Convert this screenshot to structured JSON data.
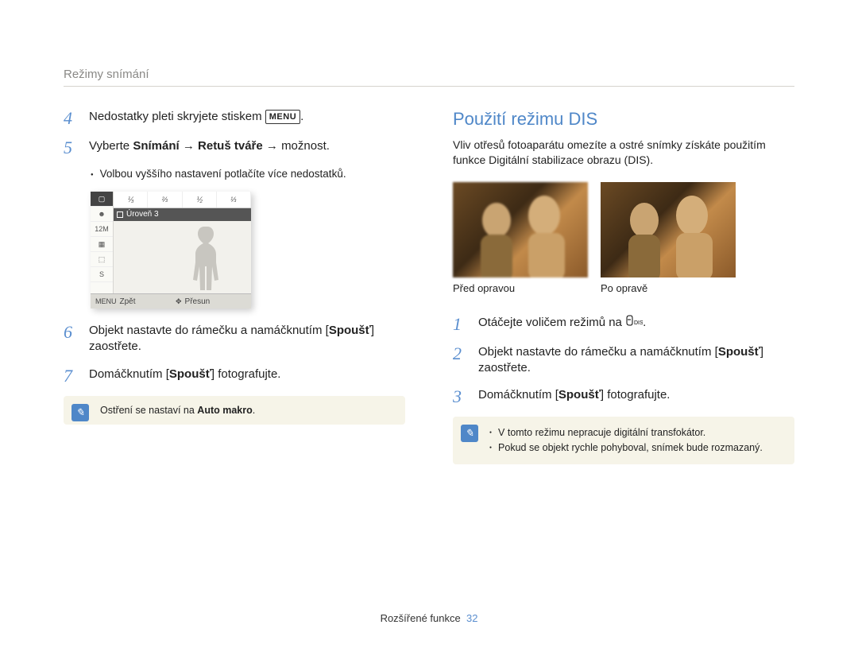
{
  "breadcrumb": "Režimy snímání",
  "left": {
    "step4": {
      "num": "4",
      "text_before": "Nedostatky pleti skryjete stiskem ",
      "menu_btn": "MENU",
      "text_after": "."
    },
    "step5": {
      "num": "5",
      "pre": "Vyberte ",
      "b1": "Snímání",
      "arrow1": " → ",
      "b2": "Retuš tváře",
      "arrow2": " → ",
      "post": "možnost."
    },
    "bullet5": "Volbou vyššího nastavení potlačíte více nedostatků.",
    "lcd": {
      "row1": [
        "⅟₃",
        "⅔",
        "⅟₂",
        "⅓"
      ],
      "level": "Úroveň 3",
      "side_icons": [
        "▢",
        "☻",
        "12M",
        "▦",
        "⬚",
        "S"
      ],
      "back_icon": "MENU",
      "back": "Zpět",
      "move_icon": "✥",
      "move": "Přesun"
    },
    "step6": {
      "num": "6",
      "pre": "Objekt nastavte do rámečku a namáčknutím [",
      "b": "Spoušť",
      "post": "] zaostřete."
    },
    "step7": {
      "num": "7",
      "pre": "Domáčknutím [",
      "b": "Spoušť",
      "post": "] fotografujte."
    },
    "note": {
      "icon": "✎",
      "text_pre": "Ostření se nastaví na ",
      "text_b": "Auto makro",
      "text_post": "."
    }
  },
  "right": {
    "title": "Použití režimu DIS",
    "intro": "Vliv otřesů fotoaparátu omezíte a ostré snímky získáte použitím funkce Digitální stabilizace obrazu (DIS).",
    "cap_before": "Před opravou",
    "cap_after": "Po opravě",
    "step1": {
      "num": "1",
      "pre": "Otáčejte voličem režimů na ",
      "icon": "",
      "post": "."
    },
    "step2": {
      "num": "2",
      "pre": "Objekt nastavte do rámečku a namáčknutím [",
      "b": "Spoušť",
      "post": "] zaostřete."
    },
    "step3": {
      "num": "3",
      "pre": "Domáčknutím [",
      "b": "Spoušť",
      "post": "] fotografujte."
    },
    "note": {
      "icon": "✎",
      "li1": "V tomto režimu nepracuje digitální transfokátor.",
      "li2": "Pokud se objekt rychle pohyboval, snímek bude rozmazaný."
    }
  },
  "footer": {
    "label": "Rozšířené funkce",
    "page": "32"
  }
}
